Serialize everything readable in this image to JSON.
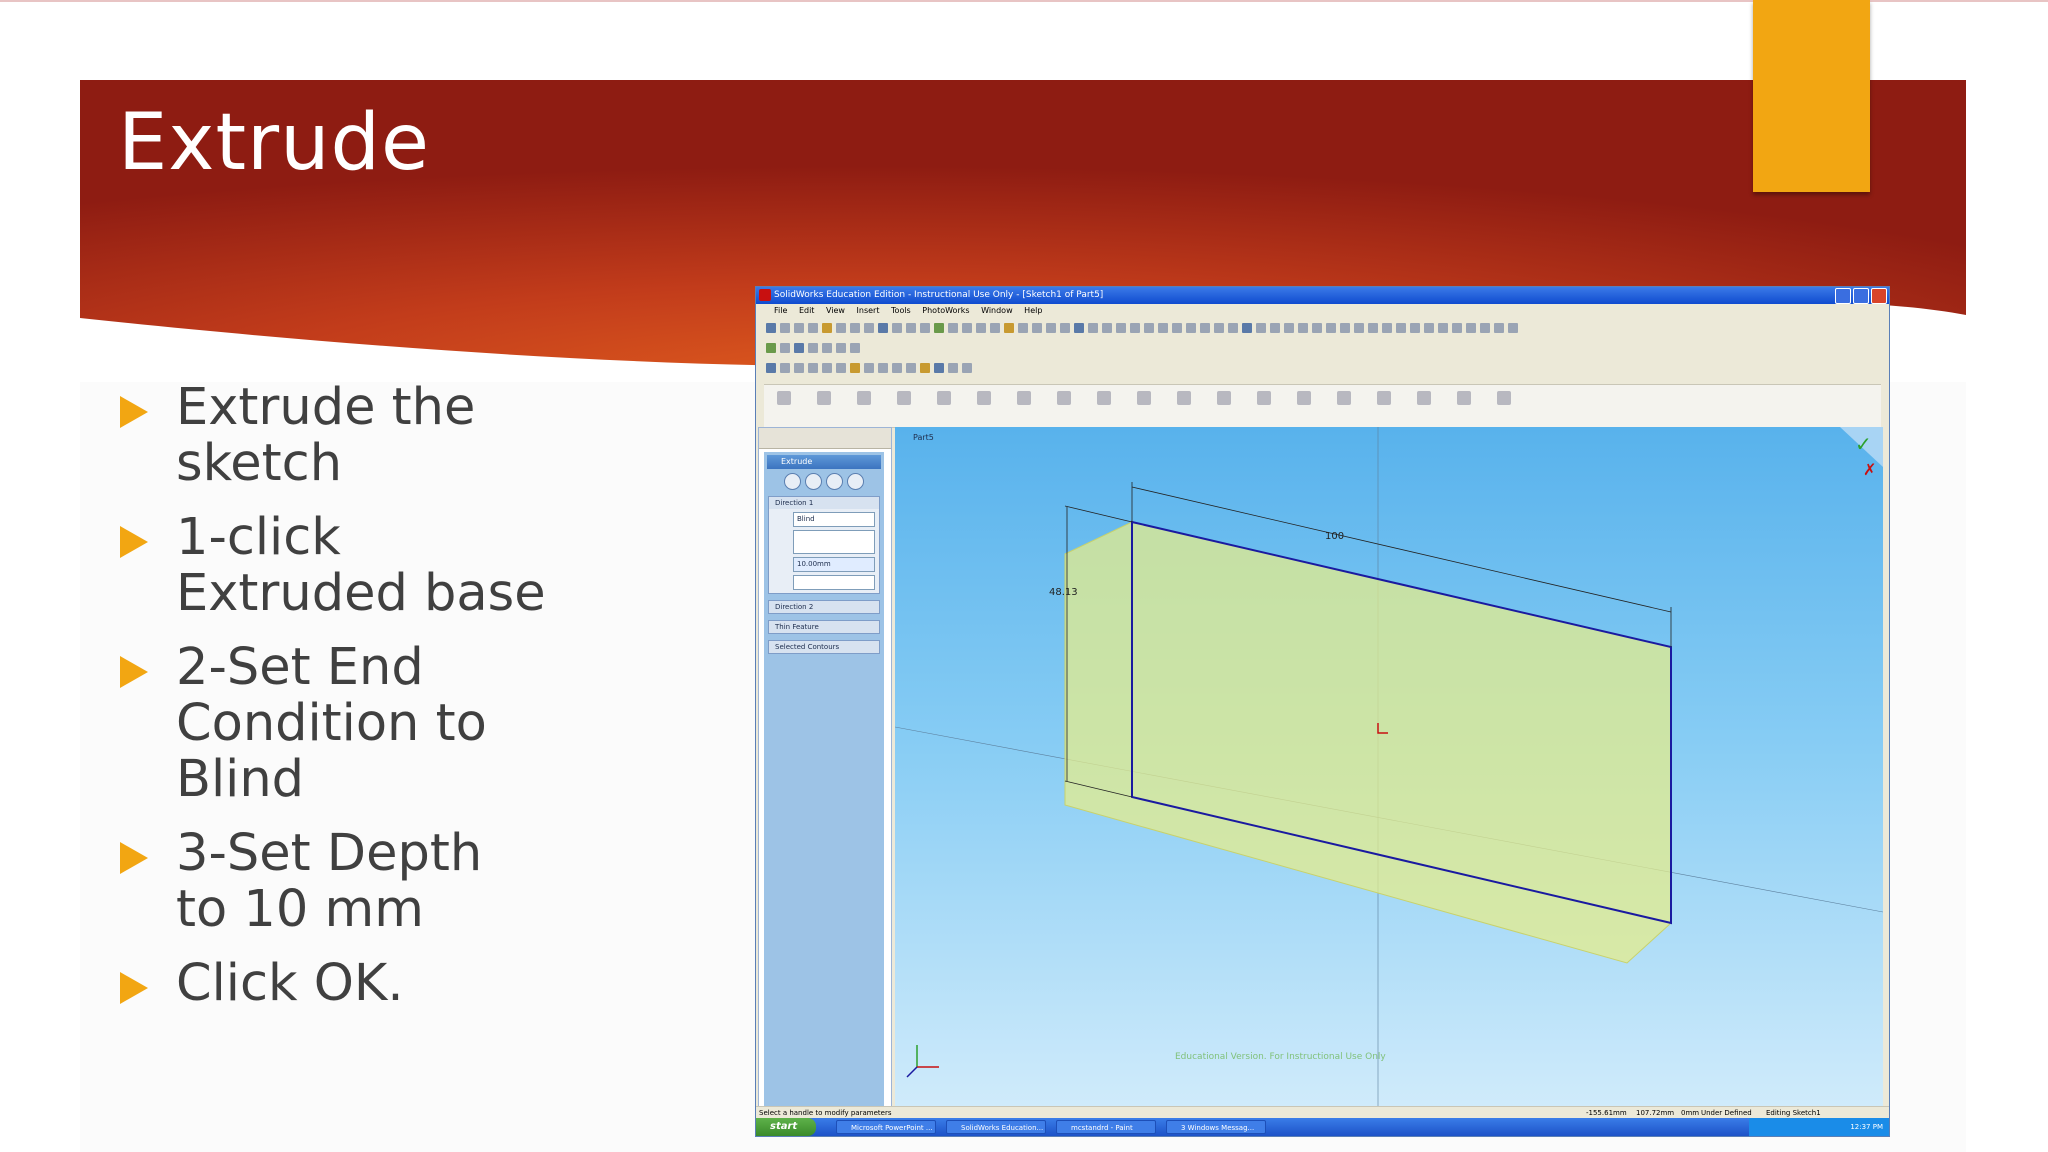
{
  "slide": {
    "title": "Extrude",
    "bullets": [
      "Extrude the sketch",
      "1-click Extruded base",
      "2-Set End Condition to Blind",
      "3-Set Depth to 10 mm",
      "Click OK."
    ],
    "colors": {
      "banner": "#b83a1c",
      "accent": "#f2a612",
      "bullet_arrow": "#f2a612",
      "text": "#404040"
    }
  },
  "solidworks": {
    "title_bar": "SolidWorks Education Edition - Instructional Use Only - [Sketch1 of Part5]",
    "menu": [
      "File",
      "Edit",
      "View",
      "Insert",
      "Tools",
      "PhotoWorks",
      "Window",
      "Help"
    ],
    "property_manager": {
      "title": "Extrude",
      "direction1_label": "Direction 1",
      "end_condition": "Blind",
      "depth": "10.00mm",
      "direction2_label": "Direction 2",
      "thin_feature_label": "Thin Feature",
      "selected_contours_label": "Selected Contours"
    },
    "tree_root": "Part5",
    "viewport": {
      "dim_width": "100",
      "dim_height": "48.13",
      "watermark": "Educational Version. For Instructional Use Only"
    },
    "status": {
      "hint": "Select a handle to modify parameters",
      "x": "-155.61mm",
      "y": "107.72mm",
      "z": "0mm",
      "state": "Under Defined",
      "mode": "Editing Sketch1"
    },
    "taskbar": {
      "start": "start",
      "tasks": [
        "Microsoft PowerPoint ...",
        "SolidWorks Education...",
        "mcstandrd - Paint",
        "3 Windows Messag..."
      ],
      "clock": "12:37 PM"
    }
  }
}
